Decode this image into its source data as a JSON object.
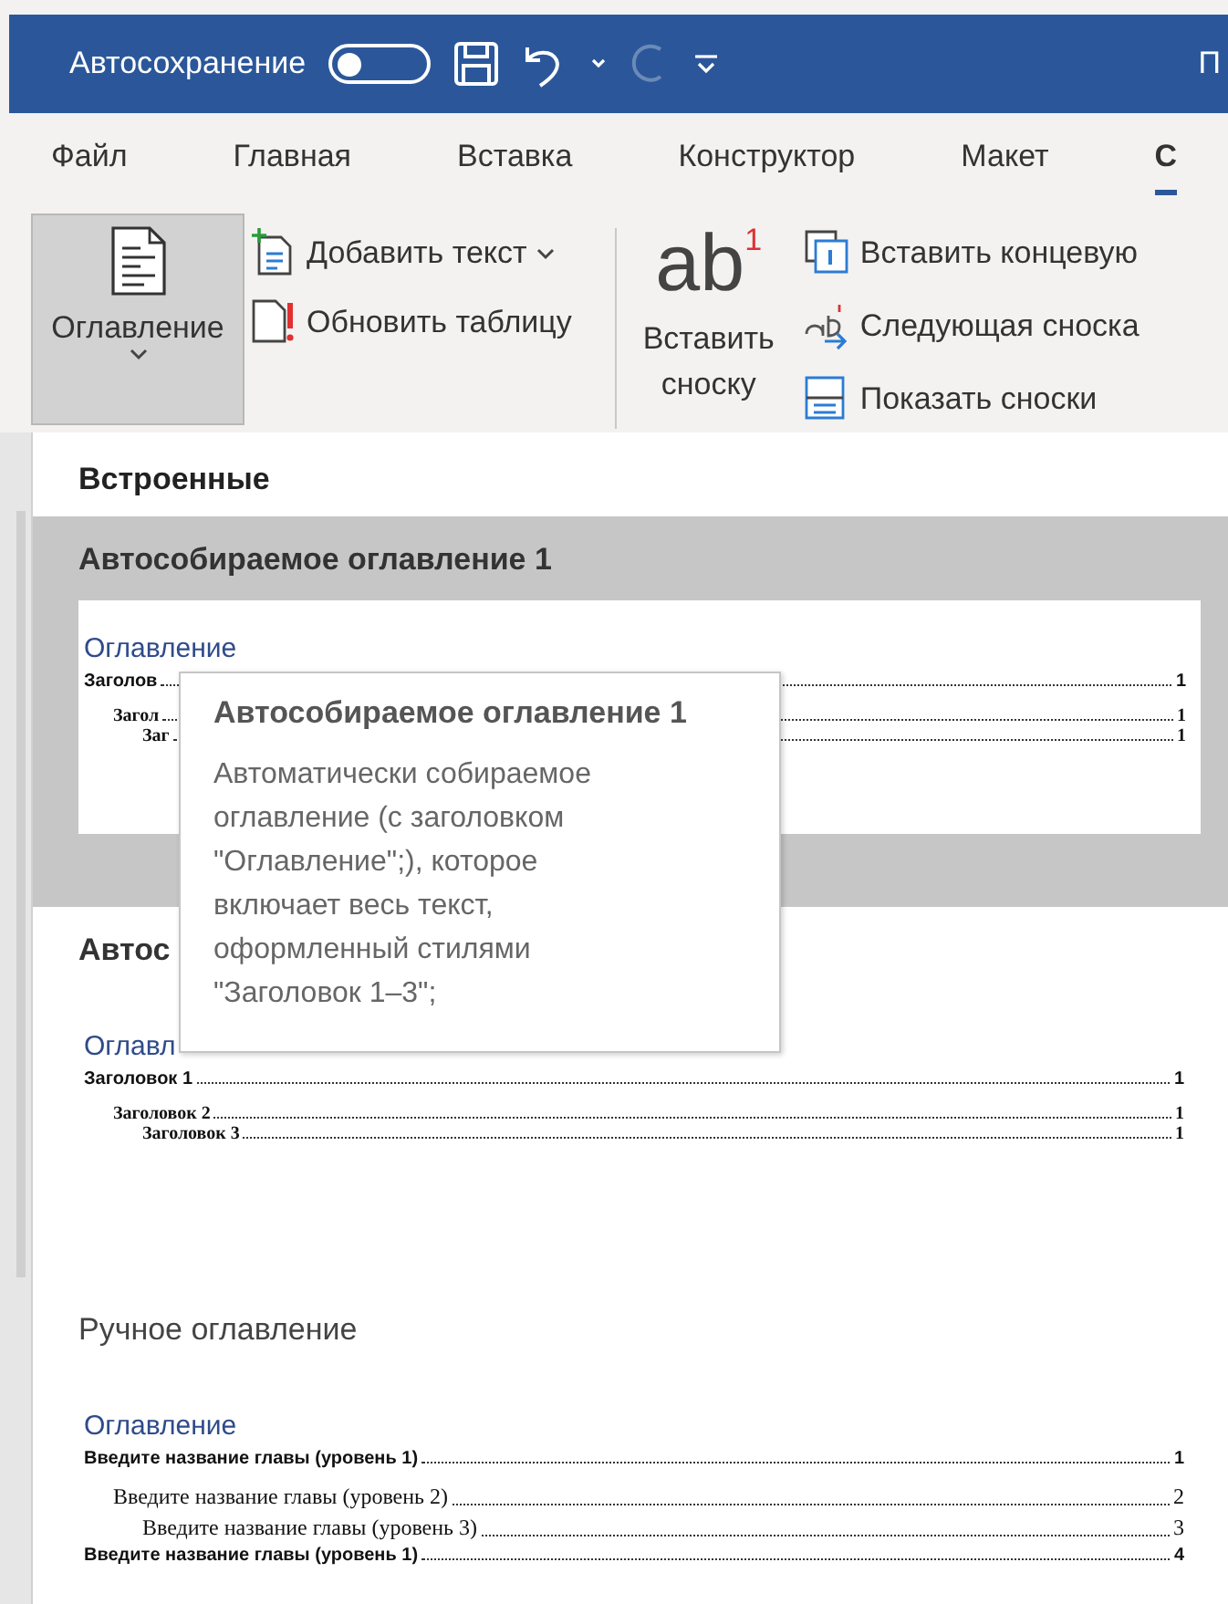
{
  "title_bar": {
    "autosave_label": "Автосохранение",
    "autosave_on": false,
    "redo_disabled": true,
    "title": "П"
  },
  "tabs": [
    {
      "label": "Файл",
      "selected": false
    },
    {
      "label": "Главная",
      "selected": false
    },
    {
      "label": "Вставка",
      "selected": false
    },
    {
      "label": "Конструктор",
      "selected": false
    },
    {
      "label": "Макет",
      "selected": false
    },
    {
      "label": "С",
      "selected": true
    }
  ],
  "ribbon": {
    "toc_button": {
      "label": "Оглавление",
      "pressed": true
    },
    "toc_commands": [
      {
        "kind": "add",
        "label": "Добавить текст",
        "dropdown": true
      },
      {
        "kind": "update",
        "label": "Обновить таблицу",
        "dropdown": false
      }
    ],
    "footnote_button": {
      "icon_text": "ab$^{1}$",
      "label": "Вставить сноску"
    },
    "footnote_commands": [
      {
        "kind": "endnote",
        "label": "Вставить концевую"
      },
      {
        "kind": "next",
        "label": "Следующая сноска"
      },
      {
        "kind": "show",
        "label": "Показать сноски"
      }
    ]
  },
  "gallery": {
    "section": "Встроенные",
    "items": [
      {
        "kind": "auto",
        "title": "Автособираемое оглавление 1",
        "selected": true,
        "toc_heading": "Оглавление",
        "entries": [
          {
            "text": "Заголов",
            "page": "1",
            "children": [
              {
                "text": "Загол",
                "page": "1",
                "children": [
                  {
                    "text": "Заг",
                    "page": "1"
                  }
                ]
              }
            ]
          }
        ]
      },
      {
        "kind": "auto",
        "title": "Автос",
        "selected": false,
        "toc_heading": "Оглавл",
        "entries": [
          {
            "text": "Заголовок 1",
            "page": "1",
            "children": [
              {
                "text": "Заголовок 2",
                "page": "1",
                "children": [
                  {
                    "text": "Заголовок 3",
                    "page": "1"
                  }
                ]
              }
            ]
          }
        ]
      },
      {
        "kind": "manual",
        "title": "Ручное оглавление",
        "selected": false,
        "toc_heading": "Оглавление",
        "entries": [
          {
            "text": "Введите название главы (уровень 1)",
            "page": "1",
            "children": [
              {
                "text": "Введите название главы (уровень 2)",
                "page": "2",
                "children": [
                  {
                    "text": "Введите название главы (уровень 3)",
                    "page": "3"
                  }
                ]
              }
            ]
          },
          {
            "text": "Введите название главы (уровень 1)",
            "page": "4"
          }
        ]
      }
    ]
  },
  "tooltip": {
    "title": "Автособираемое оглавление 1",
    "text": "Автоматически собираемое оглавление (с заголовком \"Оглавление\";), которое включает весь текст, оформленный стилями \"Заголовок 1–3\";"
  }
}
